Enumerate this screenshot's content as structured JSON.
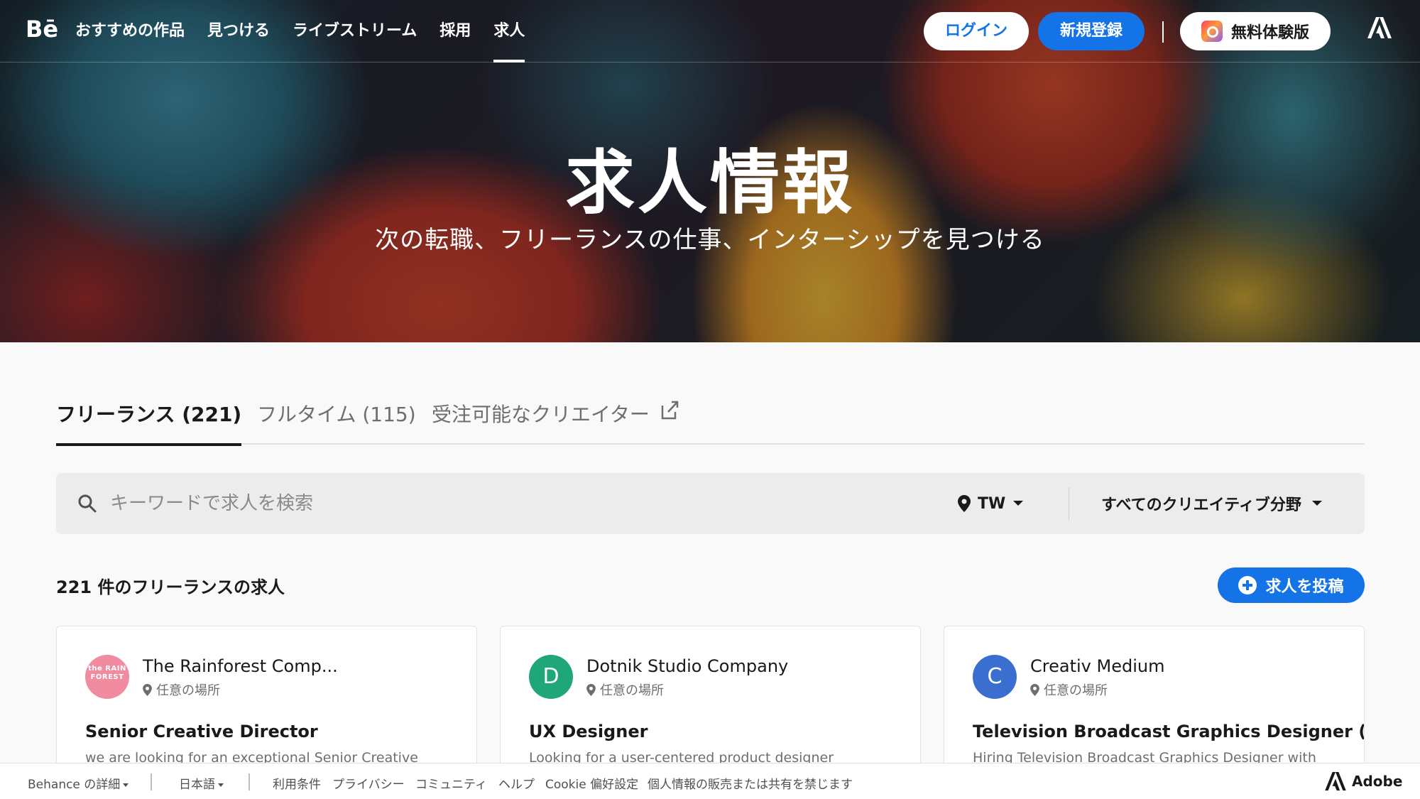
{
  "nav": {
    "logo": "Bē",
    "links": [
      "おすすめの作品",
      "見つける",
      "ライブストリーム",
      "採用",
      "求人"
    ],
    "active_link": "求人",
    "login": "ログイン",
    "signup": "新規登録",
    "trial": "無料体験版"
  },
  "hero": {
    "title": "求人情報",
    "subtitle": "次の転職、フリーランスの仕事、インターシップを見つける"
  },
  "tabs": [
    {
      "label": "フリーランス (221)",
      "active": true
    },
    {
      "label": "フルタイム (115)",
      "active": false
    },
    {
      "label": "受注可能なクリエイター",
      "active": false
    }
  ],
  "search": {
    "placeholder": "キーワードで求人を検索",
    "location": "TW",
    "category": "すべてのクリエイティブ分野"
  },
  "results": {
    "count_label": "221 件のフリーランスの求人",
    "post_button": "求人を投稿"
  },
  "jobs": [
    {
      "avatar": "the RAIN FOREST",
      "company": "The Rainforest Comp...",
      "location": "任意の場所",
      "title": "Senior Creative Director",
      "description": "we are looking for an exceptional Senior Creative"
    },
    {
      "avatar": "D",
      "company": "Dotnik Studio Company",
      "location": "任意の場所",
      "title": "UX Designer",
      "description": "Looking for a user-centered product designer"
    },
    {
      "avatar": "C",
      "company": "Creativ Medium",
      "location": "任意の場所",
      "title": "Television Broadcast Graphics Designer (Wor...",
      "description": "Hiring Television Broadcast Graphics Designer with"
    }
  ],
  "footer": {
    "more": "Behance の詳細",
    "language": "日本語",
    "links": [
      "利用条件",
      "プライバシー",
      "コミュニティ",
      "ヘルプ",
      "Cookie 偏好設定",
      "個人情報の販売または共有を禁じます"
    ],
    "brand": "Adobe"
  },
  "colors": {
    "primary": "#1473e6",
    "avatar_rain": "#f08ba0",
    "avatar_d": "#1fa77a",
    "avatar_c": "#3b6fcf"
  }
}
